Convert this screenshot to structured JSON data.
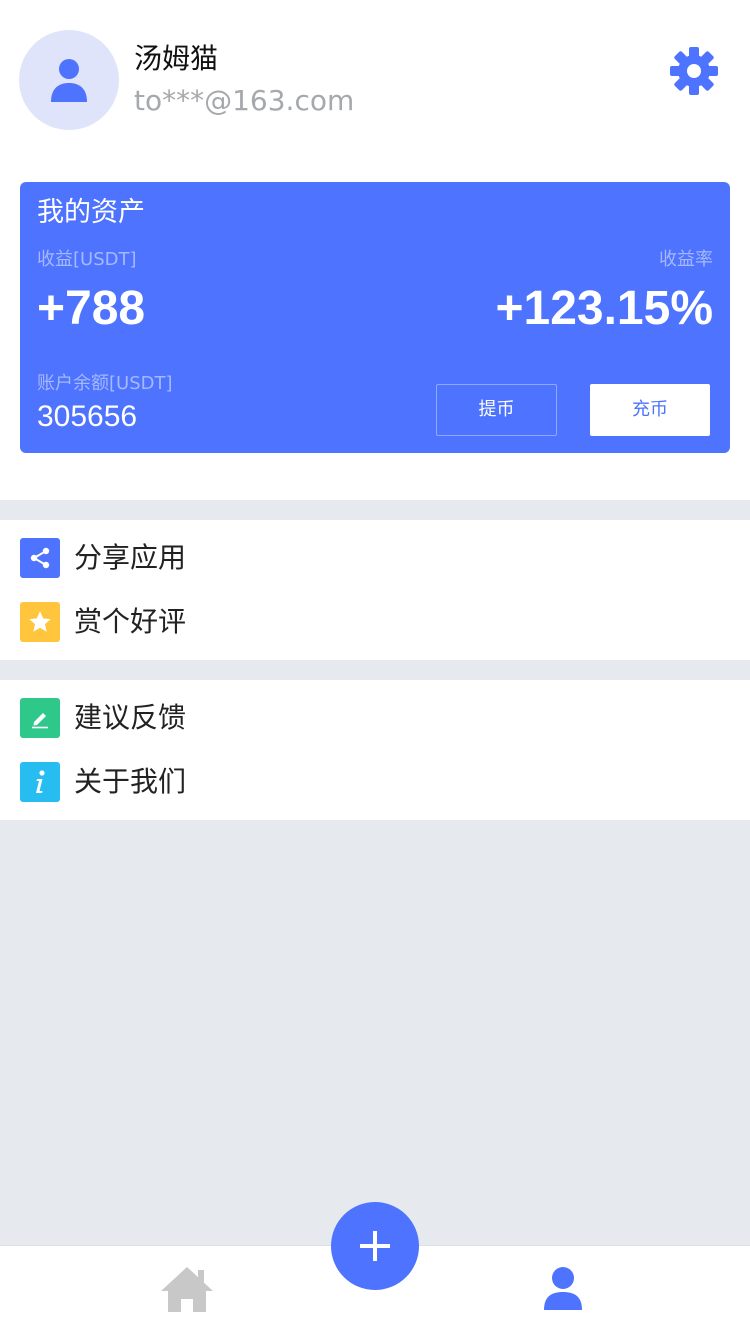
{
  "profile": {
    "name": "汤姆猫",
    "email": "to***@163.com",
    "avatar_icon": "user-icon",
    "settings_icon": "gear-icon"
  },
  "assets": {
    "title": "我的资产",
    "income_label": "收益[USDT]",
    "income_value": "+788",
    "rate_label": "收益率",
    "rate_value": "+123.15%",
    "balance_label": "账户余额[USDT]",
    "balance_value": "305656",
    "withdraw_label": "提币",
    "deposit_label": "充币"
  },
  "menu": {
    "group1": [
      {
        "label": "分享应用",
        "icon": "share-icon",
        "color": "#4d73ff"
      },
      {
        "label": "赏个好评",
        "icon": "star-icon",
        "color": "#ffc53d"
      }
    ],
    "group2": [
      {
        "label": "建议反馈",
        "icon": "edit-icon",
        "color": "#2ec88a"
      },
      {
        "label": "关于我们",
        "icon": "info-icon",
        "color": "#27bdf0"
      }
    ]
  },
  "nav": {
    "home_icon": "home-icon",
    "add_icon": "plus-icon",
    "profile_icon": "user-icon"
  },
  "colors": {
    "accent": "#4d73ff",
    "background": "#e6e9ed",
    "inactive": "#c8c8c8"
  }
}
